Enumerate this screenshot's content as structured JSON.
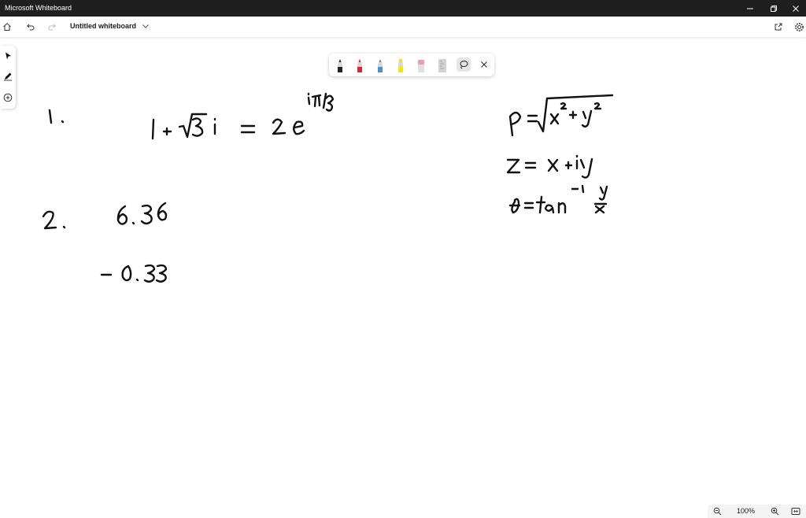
{
  "window": {
    "app_title": "Microsoft Whiteboard"
  },
  "toolbar": {
    "board_title": "Untitled whiteboard"
  },
  "pen_tray": {
    "pens": [
      {
        "name": "black-pen",
        "color": "#222222"
      },
      {
        "name": "red-pen",
        "color": "#d42b2b"
      },
      {
        "name": "blue-pen",
        "color": "#4a90c8"
      },
      {
        "name": "yellow-highlighter",
        "color": "#f2e600"
      },
      {
        "name": "pink-eraser",
        "color": "#e8a0a8"
      },
      {
        "name": "ruler",
        "color": "#c8c8c8"
      }
    ]
  },
  "zoom": {
    "level": "100%"
  }
}
